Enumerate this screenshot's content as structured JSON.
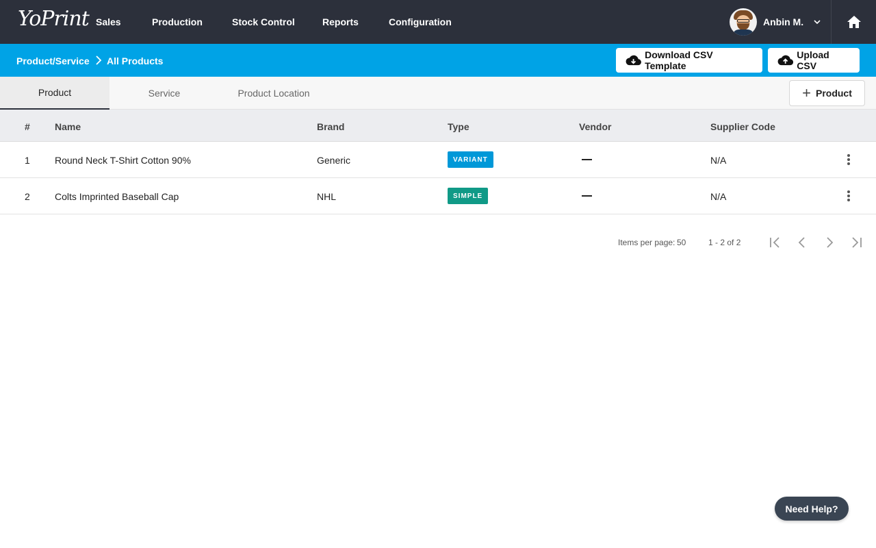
{
  "nav": {
    "logo": "YoPrint",
    "items": [
      "Sales",
      "Production",
      "Stock Control",
      "Reports",
      "Configuration"
    ],
    "user_name": "Anbin M."
  },
  "breadcrumb": {
    "parent": "Product/Service",
    "current": "All Products"
  },
  "actions": {
    "download_template": "Download CSV Template",
    "upload_csv": "Upload CSV"
  },
  "tabs": [
    "Product",
    "Service",
    "Product Location"
  ],
  "add_product_label": "Product",
  "table": {
    "columns": [
      "#",
      "Name",
      "Brand",
      "Type",
      "Vendor",
      "Supplier Code"
    ],
    "rows": [
      {
        "index": "1",
        "name": "Round Neck T-Shirt Cotton 90%",
        "brand": "Generic",
        "type": "VARIANT",
        "type_color": "#0098d8",
        "vendor": "—",
        "supplier_code": "N/A"
      },
      {
        "index": "2",
        "name": "Colts Imprinted Baseball Cap",
        "brand": "NHL",
        "type": "SIMPLE",
        "type_color": "#109a87",
        "vendor": "—",
        "supplier_code": "N/A"
      }
    ]
  },
  "pagination": {
    "items_per_page_label": "Items per page:",
    "items_per_page": "50",
    "range": "1 - 2 of 2"
  },
  "help_label": "Need Help?",
  "colors": {
    "nav_bg": "#2c303b",
    "accent_blue": "#00a3e6",
    "variant_badge": "#0098d8",
    "simple_badge": "#109a87"
  }
}
